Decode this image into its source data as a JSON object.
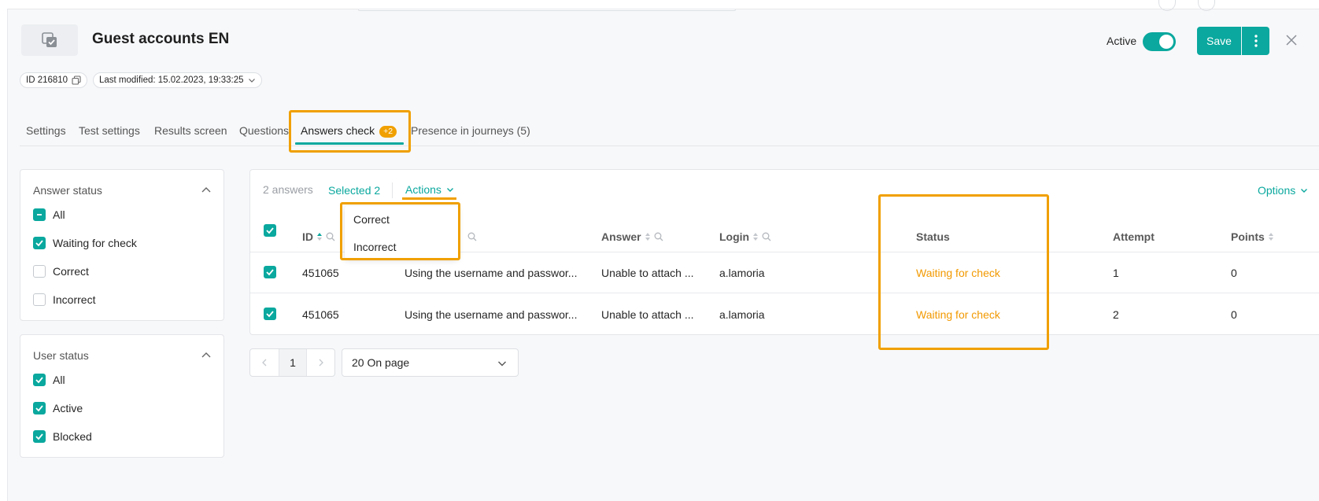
{
  "header": {
    "title": "Guest accounts EN",
    "id_chip": "ID 216810",
    "last_modified": "Last modified: 15.02.2023, 19:33:25",
    "active_label": "Active",
    "active": true,
    "save_label": "Save"
  },
  "tabs": [
    {
      "label": "Settings"
    },
    {
      "label": "Test settings"
    },
    {
      "label": "Results screen"
    },
    {
      "label": "Questions"
    },
    {
      "label": "Answers check",
      "badge": "+2",
      "active": true
    },
    {
      "label": "Presence in journeys (5)"
    }
  ],
  "filters": {
    "answer_status": {
      "title": "Answer status",
      "items": [
        {
          "label": "All",
          "state": "indeterminate"
        },
        {
          "label": "Waiting for check",
          "state": "checked"
        },
        {
          "label": "Correct",
          "state": "unchecked"
        },
        {
          "label": "Incorrect",
          "state": "unchecked"
        }
      ]
    },
    "user_status": {
      "title": "User status",
      "items": [
        {
          "label": "All",
          "state": "checked"
        },
        {
          "label": "Active",
          "state": "checked"
        },
        {
          "label": "Blocked",
          "state": "checked"
        }
      ]
    }
  },
  "table": {
    "count_label": "2 answers",
    "selected_label": "Selected 2",
    "actions_label": "Actions",
    "options_label": "Options",
    "actions_menu": [
      "Correct",
      "Incorrect"
    ],
    "columns": [
      "ID",
      "Answer",
      "Login",
      "Status",
      "Attempt",
      "Points"
    ],
    "rows": [
      {
        "id": "451065",
        "question": "Using the username and passwor...",
        "answer": "Unable to attach ...",
        "login": "a.lamoria",
        "status": "Waiting for check",
        "attempt": "1",
        "points": "0"
      },
      {
        "id": "451065",
        "question": "Using the username and passwor...",
        "answer": "Unable to attach ...",
        "login": "a.lamoria",
        "status": "Waiting for check",
        "attempt": "2",
        "points": "0"
      }
    ]
  },
  "pagination": {
    "current_page": "1",
    "per_page": "20 On page"
  },
  "colors": {
    "accent": "#0aa89e",
    "highlight": "#f0a000",
    "warning_text": "#f29900"
  }
}
